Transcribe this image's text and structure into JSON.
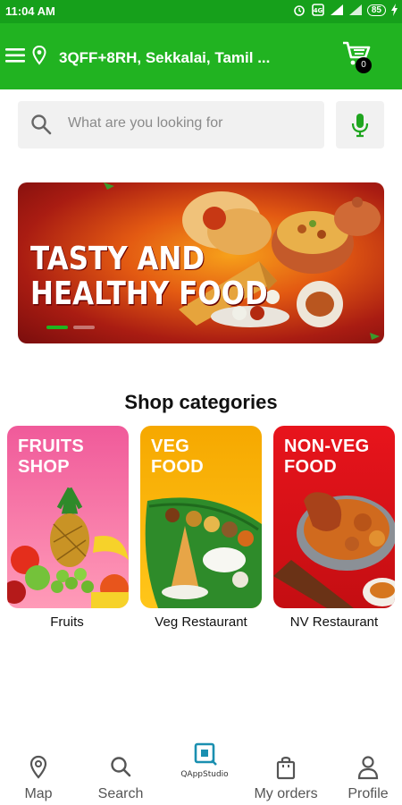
{
  "status_bar": {
    "time": "11:04 AM",
    "battery": "85"
  },
  "header": {
    "address": "3QFF+8RH, Sekkalai, Tamil ...",
    "cart_count": "0",
    "icons": [
      "menu-icon",
      "location-pin-icon",
      "cart-icon"
    ]
  },
  "search": {
    "placeholder": "What are you looking for",
    "value": ""
  },
  "banner": {
    "line1": "TASTY AND",
    "line2": "HEALTHY FOOD",
    "slides_total": 2,
    "active_slide": 1
  },
  "categories": {
    "title": "Shop categories",
    "items": [
      {
        "card_line1": "FRUITS",
        "card_line2": "SHOP",
        "label": "Fruits",
        "color_top": "#f05a9a",
        "color_bottom": "#ff9bb8"
      },
      {
        "card_line1": "VEG",
        "card_line2": "FOOD",
        "label": "Veg Restaurant",
        "color_top": "#f6a800",
        "color_bottom": "#ffc61a"
      },
      {
        "card_line1": "NON-VEG",
        "card_line2": "FOOD",
        "label": "NV Restaurant",
        "color_top": "#e8141c",
        "color_bottom": "#c40e12"
      }
    ]
  },
  "bottom_nav": {
    "items": [
      {
        "label": "Map",
        "icon": "map-pin-icon"
      },
      {
        "label": "Search",
        "icon": "search-icon"
      },
      {
        "label": "My orders",
        "icon": "shopping-bag-icon"
      },
      {
        "label": "Profile",
        "icon": "person-icon"
      }
    ],
    "brand": "QAppStudio"
  },
  "colors": {
    "primary": "#21b321",
    "status_bar": "#16a01b",
    "mic_icon": "#1fa51f"
  }
}
